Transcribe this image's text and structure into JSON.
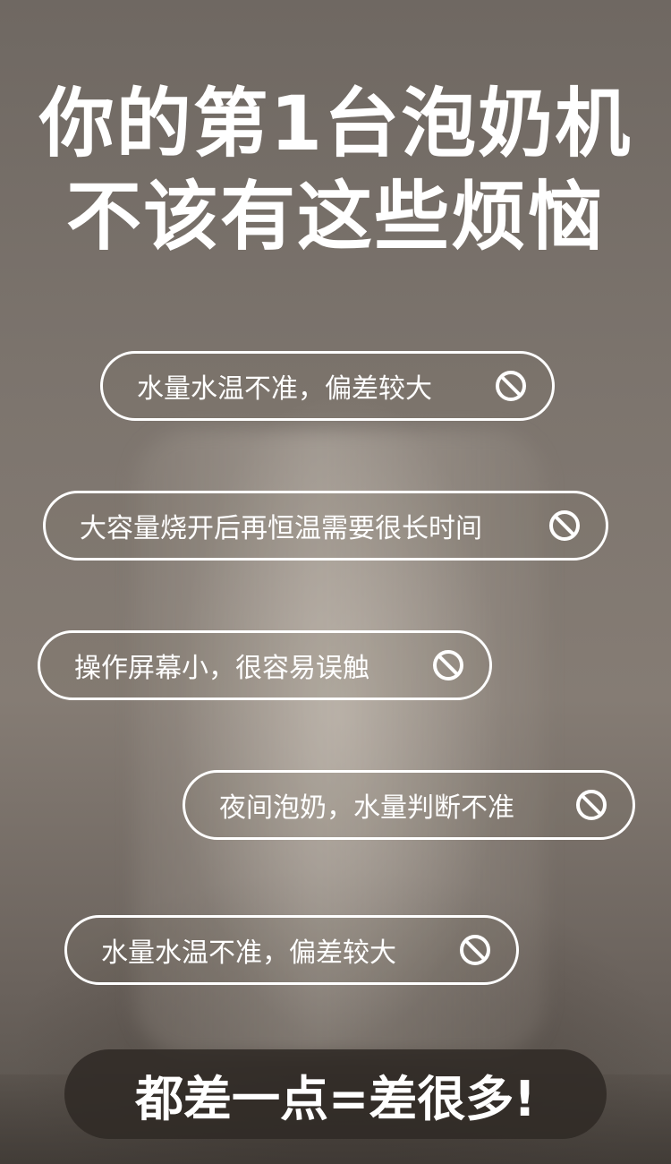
{
  "headline": {
    "line1": "你的第1台泡奶机",
    "line2": "不该有这些烦恼"
  },
  "pain_points": [
    {
      "text": "水量水温不准，偏差较大",
      "icon": "prohibited-icon"
    },
    {
      "text": "大容量烧开后再恒温需要很长时间",
      "icon": "prohibited-icon"
    },
    {
      "text": "操作屏幕小，很容易误触",
      "icon": "prohibited-icon"
    },
    {
      "text": "夜间泡奶，水量判断不准",
      "icon": "prohibited-icon"
    },
    {
      "text": "水量水温不准，偏差较大",
      "icon": "prohibited-icon"
    }
  ],
  "banner": {
    "text": "都差一点=差很多!"
  },
  "colors": {
    "text": "#ffffff",
    "background": "#7a716a",
    "banner_bg": "#302a26"
  }
}
